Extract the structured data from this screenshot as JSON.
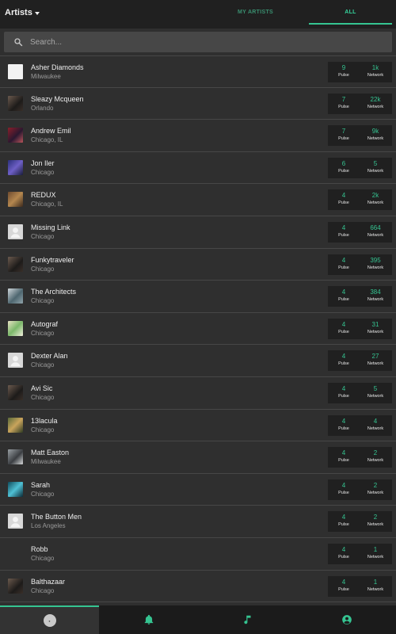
{
  "header": {
    "dropdown_label": "Artists",
    "tabs": [
      {
        "label": "MY ARTISTS",
        "active": false
      },
      {
        "label": "ALL",
        "active": true
      }
    ]
  },
  "search": {
    "placeholder": "Search...",
    "value": ""
  },
  "stats_labels": {
    "pulse": "Pulse",
    "network": "Network"
  },
  "artists": [
    {
      "name": "Asher Diamonds",
      "location": "Milwaukee",
      "pulse": "9",
      "network": "1k",
      "avatar": "sketch"
    },
    {
      "name": "Sleazy Mcqueen",
      "location": "Orlando",
      "pulse": "7",
      "network": "22k",
      "avatar": "photo-dark"
    },
    {
      "name": "Andrew Emil",
      "location": "Chicago, IL",
      "pulse": "7",
      "network": "9k",
      "avatar": "photo-red"
    },
    {
      "name": "Jon Iler",
      "location": "Chicago",
      "pulse": "6",
      "network": "5",
      "avatar": "photo-blue"
    },
    {
      "name": "REDUX",
      "location": "Chicago, IL",
      "pulse": "4",
      "network": "2k",
      "avatar": "photo-brown"
    },
    {
      "name": "Missing Link",
      "location": "Chicago",
      "pulse": "4",
      "network": "664",
      "avatar": "placeholder"
    },
    {
      "name": "Funkytraveler",
      "location": "Chicago",
      "pulse": "4",
      "network": "395",
      "avatar": "photo-dark"
    },
    {
      "name": "The Architects",
      "location": "Chicago",
      "pulse": "4",
      "network": "384",
      "avatar": "photo-slate"
    },
    {
      "name": "Autograf",
      "location": "Chicago",
      "pulse": "4",
      "network": "31",
      "avatar": "photo-green"
    },
    {
      "name": "Dexter Alan",
      "location": "Chicago",
      "pulse": "4",
      "network": "27",
      "avatar": "placeholder"
    },
    {
      "name": "Avi Sic",
      "location": "Chicago",
      "pulse": "4",
      "network": "5",
      "avatar": "photo-dark"
    },
    {
      "name": "13lacula",
      "location": "Chicago",
      "pulse": "4",
      "network": "4",
      "avatar": "photo-olive"
    },
    {
      "name": "Matt Easton",
      "location": "Milwaukee",
      "pulse": "4",
      "network": "2",
      "avatar": "photo-grey"
    },
    {
      "name": "Sarah",
      "location": "Chicago",
      "pulse": "4",
      "network": "2",
      "avatar": "photo-cyan"
    },
    {
      "name": "The Button Men",
      "location": "Los Angeles",
      "pulse": "4",
      "network": "2",
      "avatar": "placeholder"
    },
    {
      "name": "Robb",
      "location": "Chicago",
      "pulse": "4",
      "network": "1",
      "avatar": "none"
    },
    {
      "name": "Balthazaar",
      "location": "Chicago",
      "pulse": "4",
      "network": "1",
      "avatar": "photo-dark"
    }
  ],
  "bottom_nav": [
    {
      "icon": "app-logo-icon",
      "active": true
    },
    {
      "icon": "bell-icon",
      "active": false
    },
    {
      "icon": "music-note-icon",
      "active": false
    },
    {
      "icon": "account-circle-icon",
      "active": false
    }
  ],
  "colors": {
    "accent": "#35c491",
    "background": "#2f2f2f",
    "bar": "#202020"
  }
}
